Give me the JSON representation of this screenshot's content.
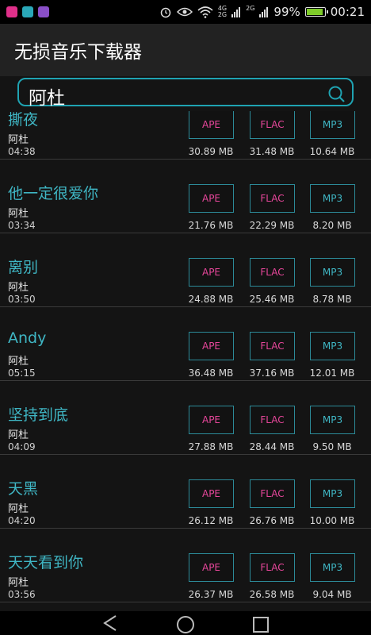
{
  "status_bar": {
    "icons": [
      "app-icon-pink",
      "app-icon-teal",
      "app-icon-purple",
      "alarm-icon",
      "eye-icon",
      "wifi-icon",
      "signal-4g-icon",
      "signal-2g-icon",
      "battery-icon"
    ],
    "net_4g": "4G",
    "net_2g_a": "2G",
    "net_2g_b": "2G",
    "battery": "99%",
    "time": "00:21"
  },
  "app": {
    "title": "无损音乐下载器"
  },
  "search": {
    "value": "阿杜",
    "icon": "search-icon"
  },
  "colors": {
    "accent": "#1fa3b2",
    "title_text": "#3fb6c4",
    "ape_flac": "#e6469a",
    "mp3": "#3fb6c4"
  },
  "songs": [
    {
      "title": "撕夜",
      "artist": "阿杜",
      "duration": "04:38",
      "formats": [
        {
          "label": "APE",
          "size": "30.89 MB"
        },
        {
          "label": "FLAC",
          "size": "31.48 MB"
        },
        {
          "label": "MP3",
          "size": "10.64 MB"
        }
      ]
    },
    {
      "title": "他一定很爱你",
      "artist": "阿杜",
      "duration": "03:34",
      "formats": [
        {
          "label": "APE",
          "size": "21.76 MB"
        },
        {
          "label": "FLAC",
          "size": "22.29 MB"
        },
        {
          "label": "MP3",
          "size": "8.20 MB"
        }
      ]
    },
    {
      "title": "离别",
      "artist": "阿杜",
      "duration": "03:50",
      "formats": [
        {
          "label": "APE",
          "size": "24.88 MB"
        },
        {
          "label": "FLAC",
          "size": "25.46 MB"
        },
        {
          "label": "MP3",
          "size": "8.78 MB"
        }
      ]
    },
    {
      "title": "Andy",
      "artist": "阿杜",
      "duration": "05:15",
      "formats": [
        {
          "label": "APE",
          "size": "36.48 MB"
        },
        {
          "label": "FLAC",
          "size": "37.16 MB"
        },
        {
          "label": "MP3",
          "size": "12.01 MB"
        }
      ]
    },
    {
      "title": "坚持到底",
      "artist": "阿杜",
      "duration": "04:09",
      "formats": [
        {
          "label": "APE",
          "size": "27.88 MB"
        },
        {
          "label": "FLAC",
          "size": "28.44 MB"
        },
        {
          "label": "MP3",
          "size": "9.50 MB"
        }
      ]
    },
    {
      "title": "天黑",
      "artist": "阿杜",
      "duration": "04:20",
      "formats": [
        {
          "label": "APE",
          "size": "26.12 MB"
        },
        {
          "label": "FLAC",
          "size": "26.76 MB"
        },
        {
          "label": "MP3",
          "size": "10.00 MB"
        }
      ]
    },
    {
      "title": "天天看到你",
      "artist": "阿杜",
      "duration": "03:56",
      "formats": [
        {
          "label": "APE",
          "size": "26.37 MB"
        },
        {
          "label": "FLAC",
          "size": "26.58 MB"
        },
        {
          "label": "MP3",
          "size": "9.04 MB"
        }
      ]
    }
  ],
  "nav_bar": {
    "icons": [
      "back-icon",
      "home-icon",
      "recents-icon"
    ]
  }
}
